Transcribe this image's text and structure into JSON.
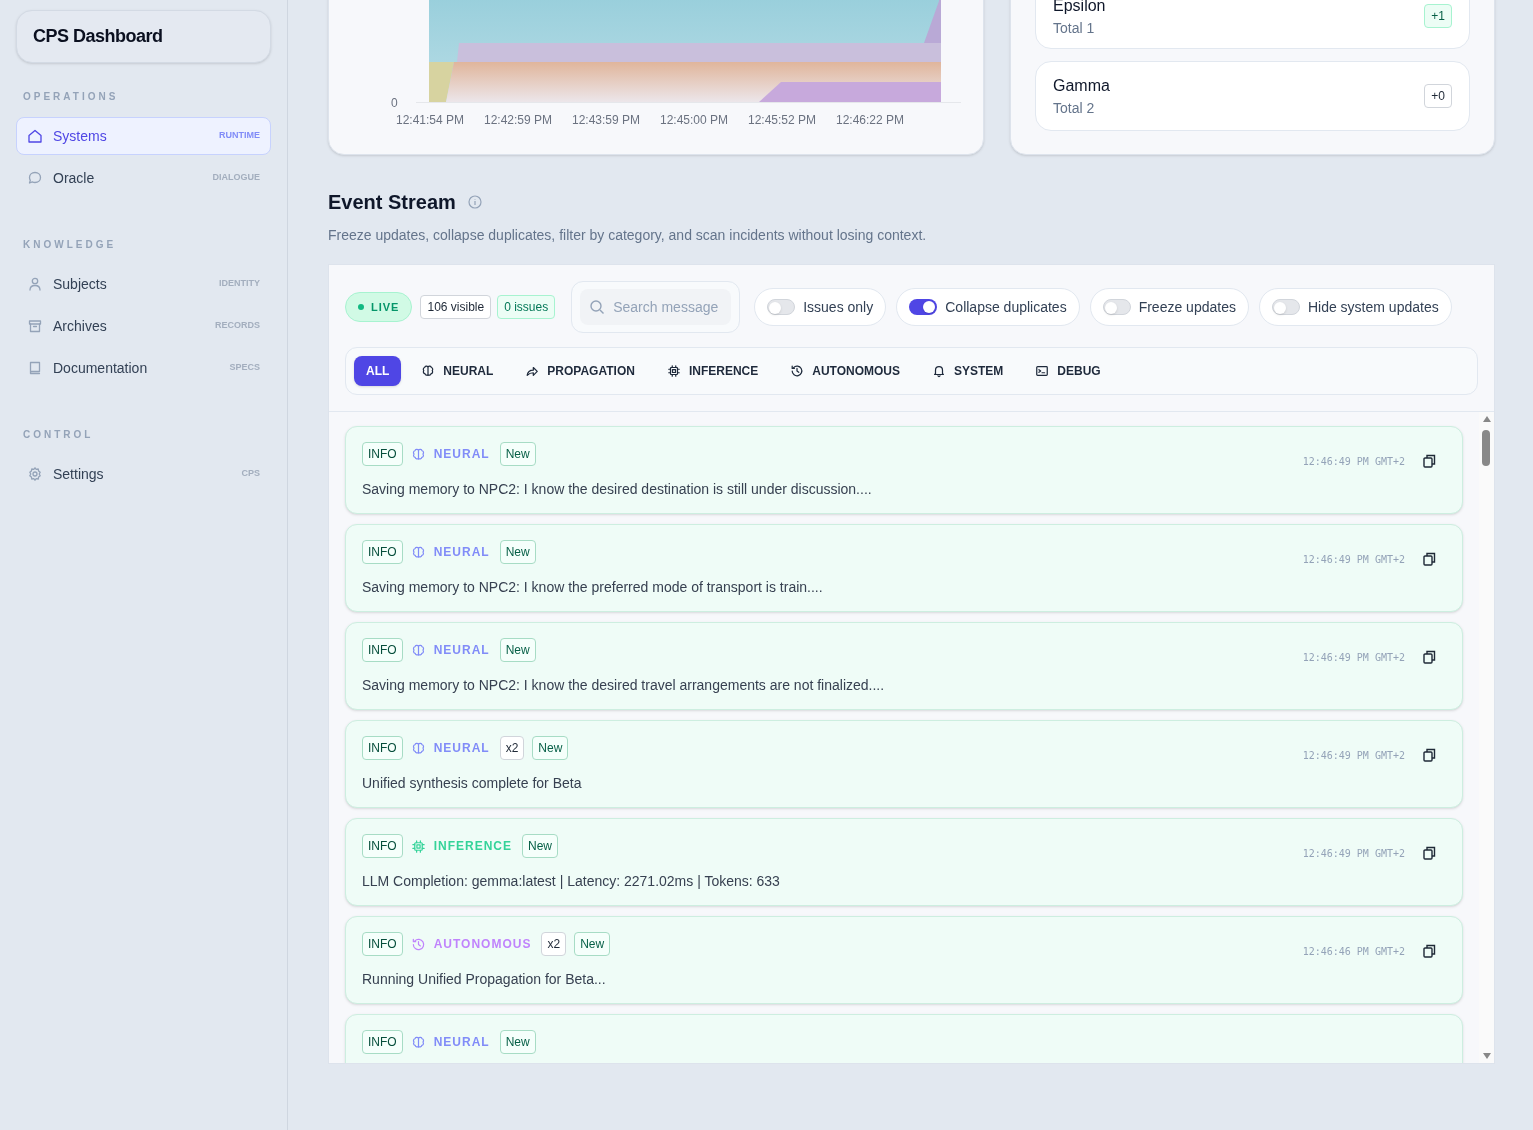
{
  "sidebar": {
    "title": "CPS Dashboard",
    "sections": [
      {
        "label": "OPERATIONS",
        "items": [
          {
            "label": "Systems",
            "tag": "RUNTIME",
            "kind": "home",
            "selected": true
          },
          {
            "label": "Oracle",
            "tag": "DIALOGUE",
            "kind": "chat",
            "selected": false
          }
        ]
      },
      {
        "label": "KNOWLEDGE",
        "items": [
          {
            "label": "Subjects",
            "tag": "IDENTITY",
            "kind": "user",
            "selected": false
          },
          {
            "label": "Archives",
            "tag": "RECORDS",
            "kind": "archive",
            "selected": false
          },
          {
            "label": "Documentation",
            "tag": "SPECS",
            "kind": "book",
            "selected": false
          }
        ]
      },
      {
        "label": "CONTROL",
        "items": [
          {
            "label": "Settings",
            "tag": "CPS",
            "kind": "gear",
            "selected": false
          }
        ]
      }
    ]
  },
  "activity_chart": {
    "y_tick": "0",
    "x_labels": [
      "12:41:54 PM",
      "12:42:59 PM",
      "12:43:59 PM",
      "12:45:00 PM",
      "12:45:52 PM",
      "12:46:22 PM"
    ]
  },
  "entity_cards": [
    {
      "name": "Epsilon",
      "total": "Total 1",
      "delta": "+1",
      "kind": "up"
    },
    {
      "name": "Gamma",
      "total": "Total 2",
      "delta": "+0",
      "kind": "flat"
    }
  ],
  "event_stream": {
    "title": "Event Stream",
    "description": "Freeze updates, collapse duplicates, filter by category, and scan incidents without losing context.",
    "live": "LIVE",
    "visible": "106 visible",
    "issues": "0 issues",
    "search": {
      "placeholder": "Search message"
    },
    "toggles": [
      {
        "label": "Issues only",
        "on": false
      },
      {
        "label": "Collapse duplicates",
        "on": true
      },
      {
        "label": "Freeze updates",
        "on": false
      },
      {
        "label": "Hide system updates",
        "on": false
      }
    ],
    "filters": [
      {
        "label": "ALL",
        "selected": true
      },
      {
        "label": "NEURAL",
        "kind": "brain",
        "selected": false
      },
      {
        "label": "PROPAGATION",
        "kind": "share",
        "selected": false
      },
      {
        "label": "INFERENCE",
        "kind": "chip",
        "selected": false
      },
      {
        "label": "AUTONOMOUS",
        "kind": "history",
        "selected": false
      },
      {
        "label": "SYSTEM",
        "kind": "bell",
        "selected": false
      },
      {
        "label": "DEBUG",
        "kind": "terminal",
        "selected": false
      }
    ],
    "events": [
      {
        "level": "INFO",
        "category": "NEURAL",
        "kind": "neural",
        "badge": "New",
        "message": "Saving memory to NPC2: I know the desired destination is still under discussion....",
        "time": "12:46:49 PM GMT+2"
      },
      {
        "level": "INFO",
        "category": "NEURAL",
        "kind": "neural",
        "badge": "New",
        "message": "Saving memory to NPC2: I know the preferred mode of transport is train....",
        "time": "12:46:49 PM GMT+2"
      },
      {
        "level": "INFO",
        "category": "NEURAL",
        "kind": "neural",
        "badge": "New",
        "message": "Saving memory to NPC2: I know the desired travel arrangements are not finalized....",
        "time": "12:46:49 PM GMT+2"
      },
      {
        "level": "INFO",
        "category": "NEURAL",
        "kind": "neural",
        "count": "x2",
        "badge": "New",
        "message": "Unified synthesis complete for Beta",
        "time": "12:46:49 PM GMT+2"
      },
      {
        "level": "INFO",
        "category": "INFERENCE",
        "kind": "inference",
        "badge": "New",
        "message": "LLM Completion: gemma:latest | Latency: 2271.02ms | Tokens: 633",
        "time": "12:46:49 PM GMT+2"
      },
      {
        "level": "INFO",
        "category": "AUTONOMOUS",
        "kind": "autonomous",
        "count": "x2",
        "badge": "New",
        "message": "Running Unified Propagation for Beta...",
        "time": "12:46:46 PM GMT+2"
      },
      {
        "level": "INFO",
        "category": "NEURAL",
        "kind": "neural",
        "badge": "New"
      }
    ]
  }
}
